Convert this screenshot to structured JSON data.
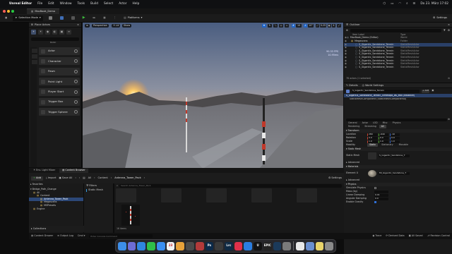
{
  "mac_menubar": {
    "app_name": "Unreal Editor",
    "menu_items": [
      "File",
      "Edit",
      "Window",
      "Tools",
      "Build",
      "Select",
      "Actor",
      "Help"
    ],
    "clock": "Do 23. März 17:02"
  },
  "project_tab": {
    "title": "MacBook_Demo"
  },
  "toolbar": {
    "selection_mode": "Selection Mode",
    "platforms": "Platforms",
    "settings": "Settings"
  },
  "place_actors": {
    "title": "Place Actors",
    "category_label": "BASIC",
    "items": [
      {
        "label": "Actor",
        "icon": "actor-icon"
      },
      {
        "label": "Character",
        "icon": "character-icon"
      },
      {
        "label": "Pawn",
        "icon": "pawn-icon"
      },
      {
        "label": "Point Light",
        "icon": "point-light-icon"
      },
      {
        "label": "Player Start",
        "icon": "player-start-icon"
      },
      {
        "label": "Trigger Box",
        "icon": "trigger-box-icon"
      },
      {
        "label": "Trigger Sphere",
        "icon": "trigger-sphere-icon"
      }
    ]
  },
  "viewport": {
    "perspective": "Perspective",
    "lit": "Lit",
    "show": "Show",
    "stats": [
      "90.33 FPS",
      "10.95ms"
    ],
    "snap_values": [
      "10",
      "10°",
      "0.25",
      "4"
    ]
  },
  "outliner": {
    "title": "Outliner",
    "col_label": "Item Label",
    "col_type": "Type",
    "rows": [
      {
        "label": "MacBook_Demo (Editor)",
        "type": "World",
        "indent": 0
      },
      {
        "label": "Megascans",
        "type": "Folder",
        "indent": 1
      },
      {
        "label": "S_Gigantic_Sandstone_Terrain",
        "type": "StaticMeshActor",
        "indent": 2,
        "selected": true
      },
      {
        "label": "S_Gigantic_Sandstone_Terrain",
        "type": "StaticMeshActor",
        "indent": 2
      },
      {
        "label": "S_Gigantic_Sandstone_Terrain",
        "type": "StaticMeshActor",
        "indent": 2
      },
      {
        "label": "S_Gigantic_Sandstone_Terrain",
        "type": "StaticMeshActor",
        "indent": 2
      },
      {
        "label": "S_Gigantic_Sandstone_Terrain",
        "type": "StaticMeshActor",
        "indent": 2
      },
      {
        "label": "S_Gigantic_Sandstone_Terrain",
        "type": "StaticMeshActor",
        "indent": 2
      },
      {
        "label": "S_Gigantic_Sandstone_Terrain",
        "type": "StaticMeshActor",
        "indent": 2
      },
      {
        "label": "S_Gigantic_Sandstone_Terrain",
        "type": "StaticMeshActor",
        "indent": 2
      }
    ],
    "count": "78 actors (1 selected)"
  },
  "details": {
    "tab_details": "Details",
    "tab_world": "World Settings",
    "actor_name": "S_Gigantic_Sandstone_Terrain",
    "add_label": "+ Add",
    "component_root": "S_Gigantic_Sandstone_Terrain_vif9ekqia_8K_Mid (Instance)",
    "component_child": "StaticMeshComponent (StaticMeshComponent0)",
    "subtabs": [
      "General",
      "Actor",
      "LOD",
      "Misc",
      "Physics"
    ],
    "subtabs2": [
      "Rendering",
      "Streaming",
      "All"
    ],
    "transform_section": "Transform",
    "location": {
      "label": "Location",
      "x": "280",
      "y": "-640",
      "z": "-10"
    },
    "rotation": {
      "label": "Rotation",
      "x": "0.0",
      "y": "0.0",
      "z": "0.0"
    },
    "scale": {
      "label": "Scale",
      "x": "1.0",
      "y": "1.0",
      "z": "1.0"
    },
    "mobility": {
      "label": "Mobility",
      "options": [
        "Static",
        "Stationary",
        "Movable"
      ]
    },
    "static_mesh_section": "Static Mesh",
    "static_mesh_label": "Static Mesh",
    "static_mesh_value": "S_Gigantic_Sandstone_T",
    "advanced": "Advanced",
    "materials_section": "Materials",
    "element0_label": "Element 0",
    "element0_value": "MI_Gigantic_Sandstone_T",
    "physics_section": "Physics",
    "simulate_physics": "Simulate Physics",
    "mass_label": "Mass (kg)",
    "linear_damping": "Linear Damping",
    "angular_damping": "Angular Damping",
    "enable_gravity": "Enable Gravity",
    "linear_damping_value": "0.01",
    "angular_damping_value": "0.0"
  },
  "bottom_tabs": [
    "Env. Light Mixer",
    "Content Browser"
  ],
  "content_browser": {
    "add": "Add",
    "import": "Import",
    "save_all": "Save All",
    "breadcrumb": [
      "All",
      "Content",
      "Antenna_Tower_Pack"
    ],
    "settings": "Settings",
    "favorites": "Favorites",
    "project": "Bridge_Path_Change",
    "tree": [
      {
        "label": "All",
        "indent": 0
      },
      {
        "label": "Content",
        "indent": 1
      },
      {
        "label": "Antenna_Tower_Pack",
        "indent": 2,
        "selected": true
      },
      {
        "label": "Megascans",
        "indent": 2
      },
      {
        "label": "MSPresets",
        "indent": 2
      },
      {
        "label": "Engine",
        "indent": 0
      }
    ],
    "filters": "Filters",
    "filter_item": "Static Mesh",
    "search_placeholder": "Search Antenna_Tower_Pack",
    "item_count": "16 items",
    "collections": "Collections"
  },
  "statusbar": {
    "content_drawer": "Content Drawer",
    "output_log": "Output Log",
    "cmd": "Cmd",
    "cmd_placeholder": "Enter Console Command",
    "trace": "Trace",
    "derived_data": "Derived Data",
    "all_saved": "All Saved",
    "revision_control": "Revision Control"
  },
  "dock": {
    "apps": [
      {
        "name": "finder-icon",
        "color": "#3d8ee8",
        "glyph": ""
      },
      {
        "name": "launchpad-icon",
        "color": "#6d6dd6",
        "glyph": ""
      },
      {
        "name": "safari-icon",
        "color": "#2f86e0",
        "glyph": ""
      },
      {
        "name": "whatsapp-icon",
        "color": "#2fbf4a",
        "glyph": ""
      },
      {
        "name": "mail-icon",
        "color": "#3a8ef0",
        "glyph": ""
      },
      {
        "name": "calendar-icon",
        "color": "#f2f2f2",
        "glyph": "23"
      },
      {
        "name": "photos-icon",
        "color": "#e7a13a",
        "glyph": ""
      },
      {
        "name": "files-icon",
        "color": "#4a4a4a",
        "glyph": ""
      },
      {
        "name": "davinci-icon",
        "color": "#b33a3a",
        "glyph": ""
      },
      {
        "name": "photoshop-icon",
        "color": "#0b2a4a",
        "glyph": "Ps"
      },
      {
        "name": "finalcut-icon",
        "color": "#3a3a3a",
        "glyph": ""
      },
      {
        "name": "lightroom-icon",
        "color": "#0f2a44",
        "glyph": "Lrc"
      },
      {
        "name": "music-icon",
        "color": "#e0304a",
        "glyph": ""
      },
      {
        "name": "appstore-icon",
        "color": "#2a7de0",
        "glyph": ""
      },
      {
        "name": "unreal-icon",
        "color": "#111111",
        "glyph": "U"
      },
      {
        "name": "epic-icon",
        "color": "#222222",
        "glyph": "EPIC"
      },
      {
        "name": "bridge-icon",
        "color": "#1b3a5a",
        "glyph": ""
      },
      {
        "name": "settings-icon",
        "color": "#7a7a7a",
        "glyph": ""
      },
      {
        "name": "chrome-icon",
        "color": "#e8e8e8",
        "glyph": ""
      },
      {
        "name": "preview-icon",
        "color": "#6a8fcf",
        "glyph": ""
      },
      {
        "name": "notes-icon",
        "color": "#e8d36a",
        "glyph": ""
      },
      {
        "name": "trash-icon",
        "color": "#8a8a8a",
        "glyph": ""
      }
    ]
  },
  "colors": {
    "accent_blue": "#1e64c8",
    "play_green": "#3cbf3c",
    "sun_orange": "#ff9a2e",
    "selection": "#2a4068"
  }
}
